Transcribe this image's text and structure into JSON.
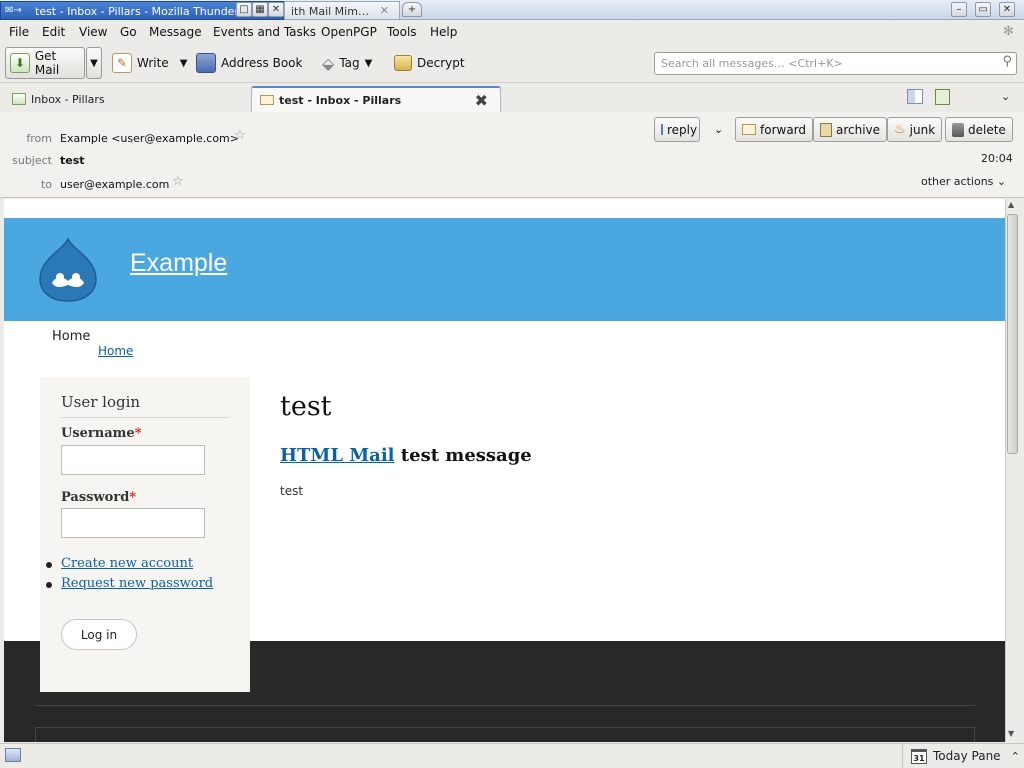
{
  "window": {
    "active_tab_title": "test - Inbox - Pillars - Mozilla Thunderbird",
    "inactive_tab_title": "ith Mail Mim…",
    "add_tab": "+"
  },
  "menu": [
    "File",
    "Edit",
    "View",
    "Go",
    "Message",
    "Events and Tasks",
    "OpenPGP",
    "Tools",
    "Help"
  ],
  "toolbar": {
    "get_mail": "Get Mail",
    "write": "Write",
    "address_book": "Address Book",
    "tag": "Tag",
    "decrypt": "Decrypt",
    "search_placeholder": "Search all messages… <Ctrl+K>"
  },
  "tabs": {
    "inbox": "Inbox - Pillars",
    "message": "test - Inbox - Pillars"
  },
  "message": {
    "from_label": "from",
    "from": "Example <user@example.com>",
    "subject_label": "subject",
    "subject": "test",
    "to_label": "to",
    "to": "user@example.com",
    "time": "20:04",
    "other_actions": "other actions",
    "actions": {
      "reply": "reply",
      "forward": "forward",
      "archive": "archive",
      "junk": "junk",
      "delete": "delete"
    }
  },
  "email": {
    "site_name": "Example",
    "breadcrumb_title": "Home",
    "breadcrumb_link": "Home",
    "login_title": "User login",
    "username_label": "Username",
    "password_label": "Password",
    "required_mark": "*",
    "create_account": "Create new account",
    "request_password": "Request new password",
    "login_button": "Log in",
    "page_title": "test",
    "subtitle_link": "HTML Mail",
    "subtitle_rest": "test message",
    "body": "test"
  },
  "status": {
    "today_pane": "Today Pane",
    "calendar_day": "31"
  },
  "colors": {
    "site_header": "#4ba7e0",
    "footer": "#292829",
    "link": "#0a61a8"
  }
}
